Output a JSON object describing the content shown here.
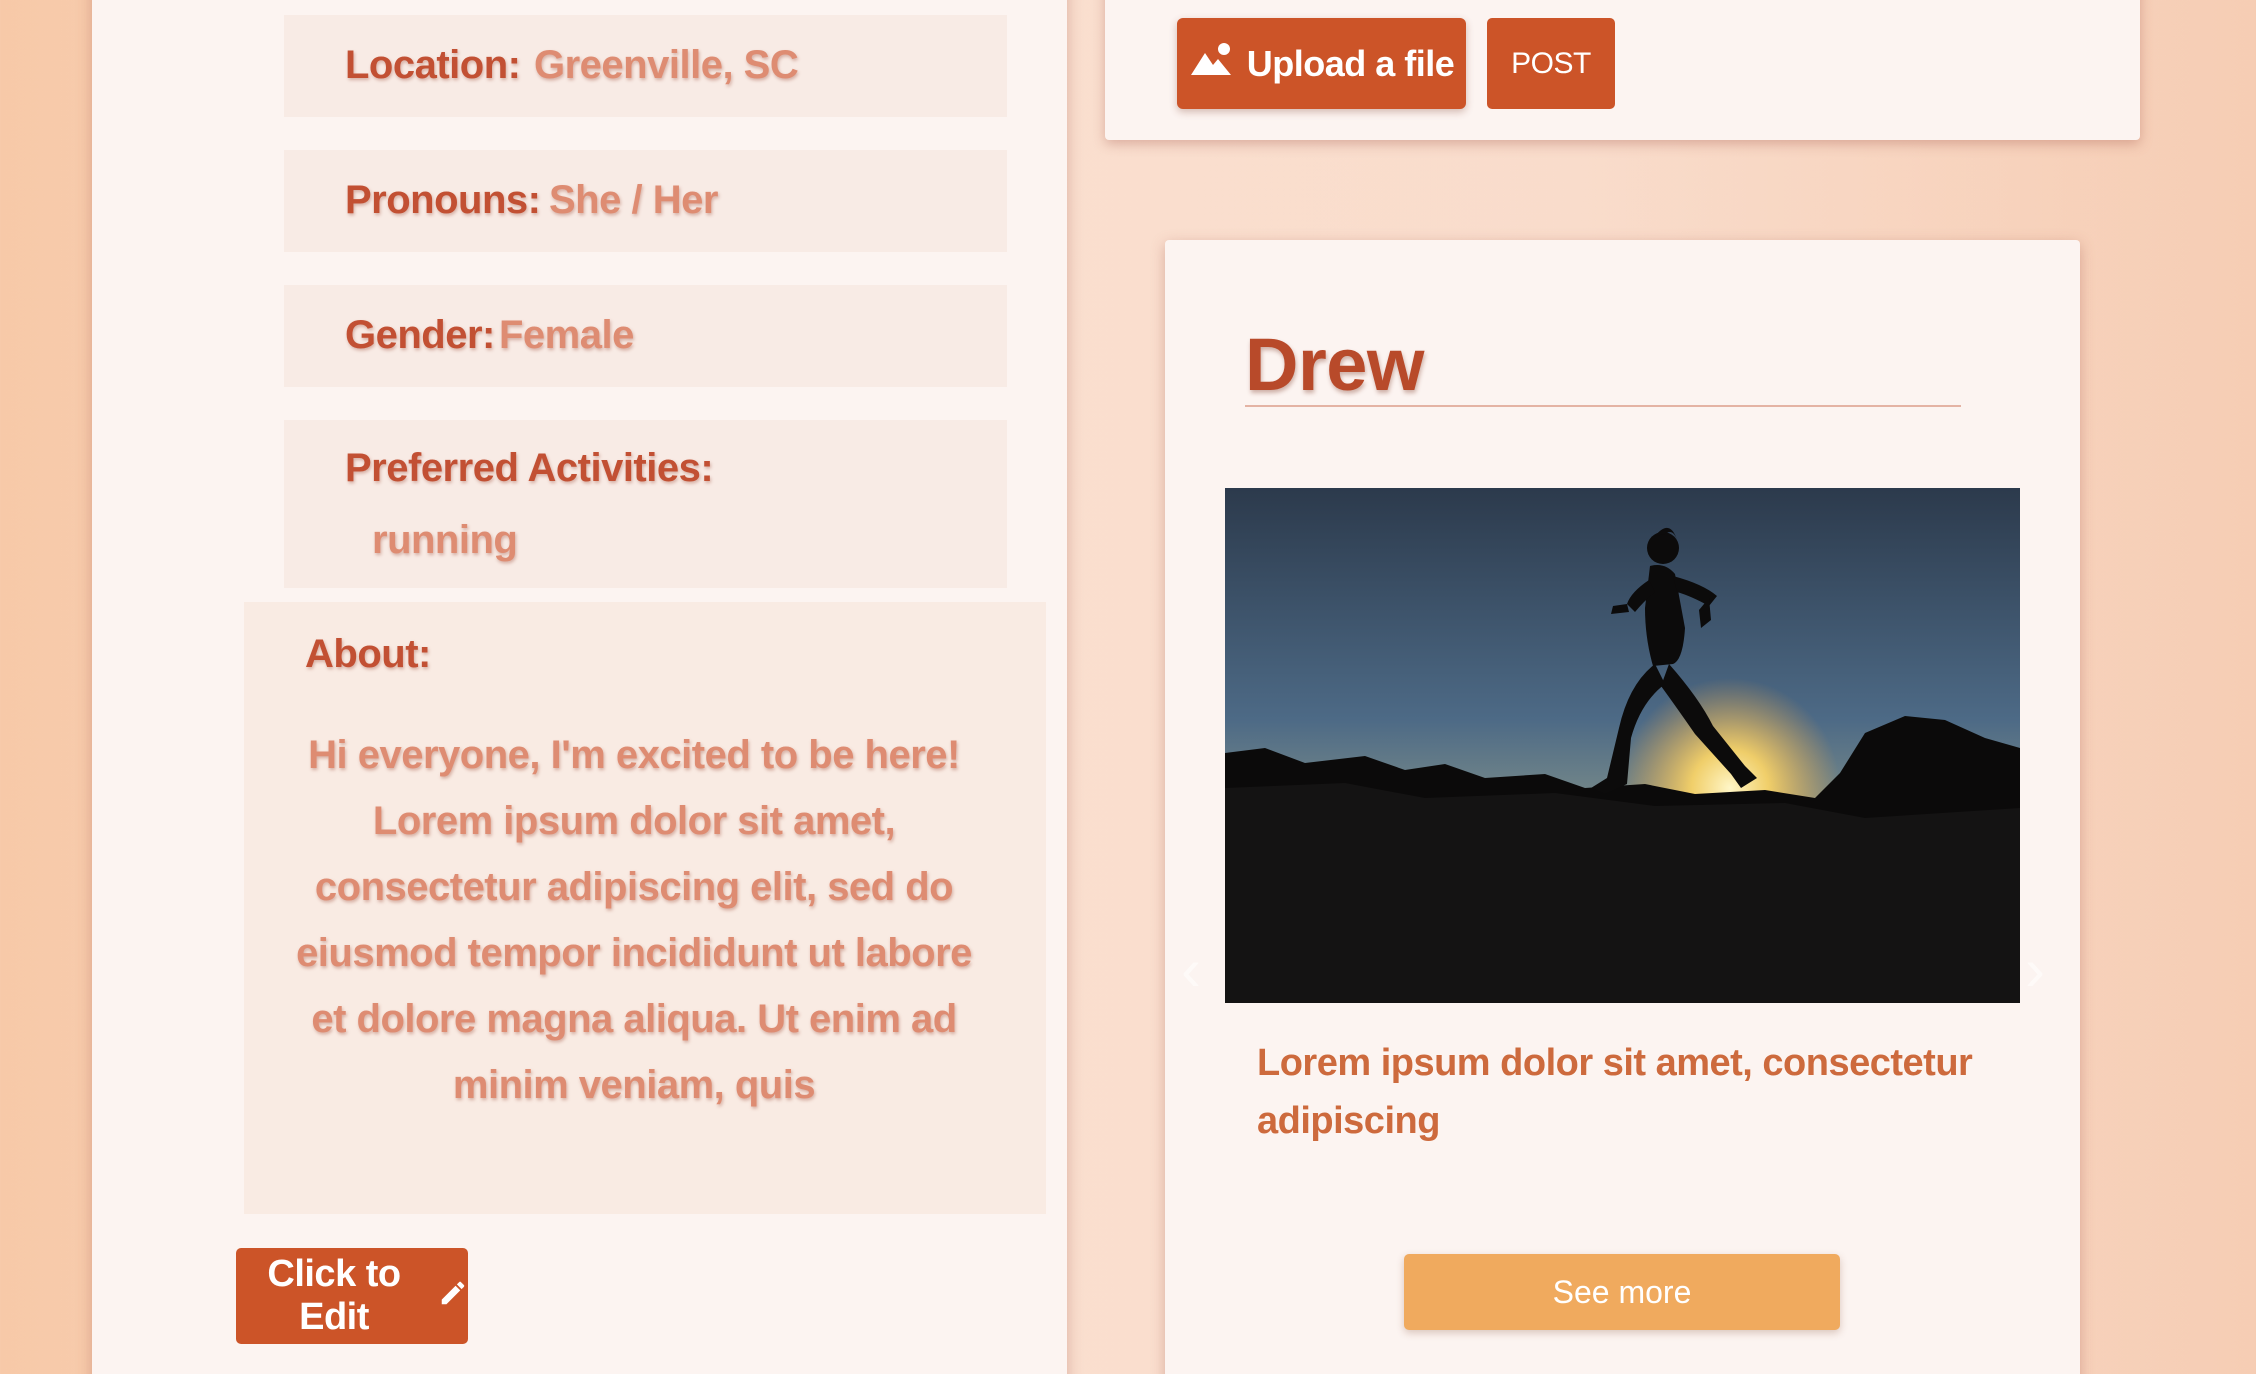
{
  "profile": {
    "location": {
      "label": "Location:",
      "value": "Greenville, SC"
    },
    "pronouns": {
      "label": "Pronouns:",
      "value": "She / Her"
    },
    "gender": {
      "label": "Gender:",
      "value": "Female"
    },
    "activities": {
      "label": "Preferred Activities:",
      "value": "running"
    },
    "about": {
      "label": "About:",
      "text": "Hi everyone, I'm excited to be here! Lorem ipsum dolor sit amet, consectetur adipiscing elit, sed do eiusmod tempor incididunt ut labore et dolore magna aliqua. Ut enim ad minim veniam, quis"
    },
    "edit_label": "Click to Edit"
  },
  "composer": {
    "upload_label": "Upload a file",
    "post_label": "POST"
  },
  "post": {
    "author": "Drew",
    "caption": "Lorem ipsum dolor sit amet, consectetur adipiscing",
    "see_more_label": "See more"
  },
  "colors": {
    "accent": "#cc5428",
    "accent_light": "#f0aa5e",
    "label": "#c25033",
    "value": "#de8c72"
  },
  "icons": {
    "upload": "image-icon",
    "edit": "pencil-icon",
    "prev": "chevron-left-icon",
    "next": "chevron-right-icon"
  }
}
